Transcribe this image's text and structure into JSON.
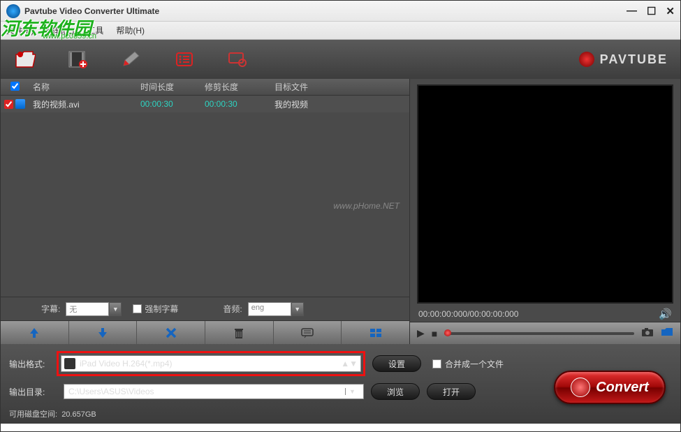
{
  "titlebar": {
    "title": "Pavtube Video Converter Ultimate"
  },
  "menubar": {
    "items": [
      "文件(F)",
      "编辑(E)",
      "工具",
      "帮助(H)"
    ]
  },
  "watermark": {
    "logo": "河东软件园",
    "url": "www.pc0359.cn",
    "center": "www.pHome.NET"
  },
  "brand": {
    "name": "PAVTUBE"
  },
  "table": {
    "headers": {
      "name": "名称",
      "duration": "时间长度",
      "trim": "修剪长度",
      "target": "目标文件"
    },
    "rows": [
      {
        "name": "我的视频.avi",
        "duration": "00:00:30",
        "trim": "00:00:30",
        "target": "我的视频"
      }
    ]
  },
  "subtitle": {
    "label": "字幕:",
    "value": "无",
    "force": "强制字幕",
    "audio_label": "音频:",
    "audio_value": "eng"
  },
  "preview": {
    "time": "00:00:00:000/00:00:00:000"
  },
  "format": {
    "label": "输出格式:",
    "value": "iPad Video H.264(*.mp4)",
    "settings": "设置",
    "merge": "合并成一个文件"
  },
  "output": {
    "label": "输出目录:",
    "path": "C:\\Users\\ASUS\\Videos",
    "browse": "浏览",
    "open": "打开"
  },
  "convert": {
    "label": "Convert"
  },
  "disk": {
    "label": "可用磁盘空间:",
    "value": "20.657GB"
  }
}
